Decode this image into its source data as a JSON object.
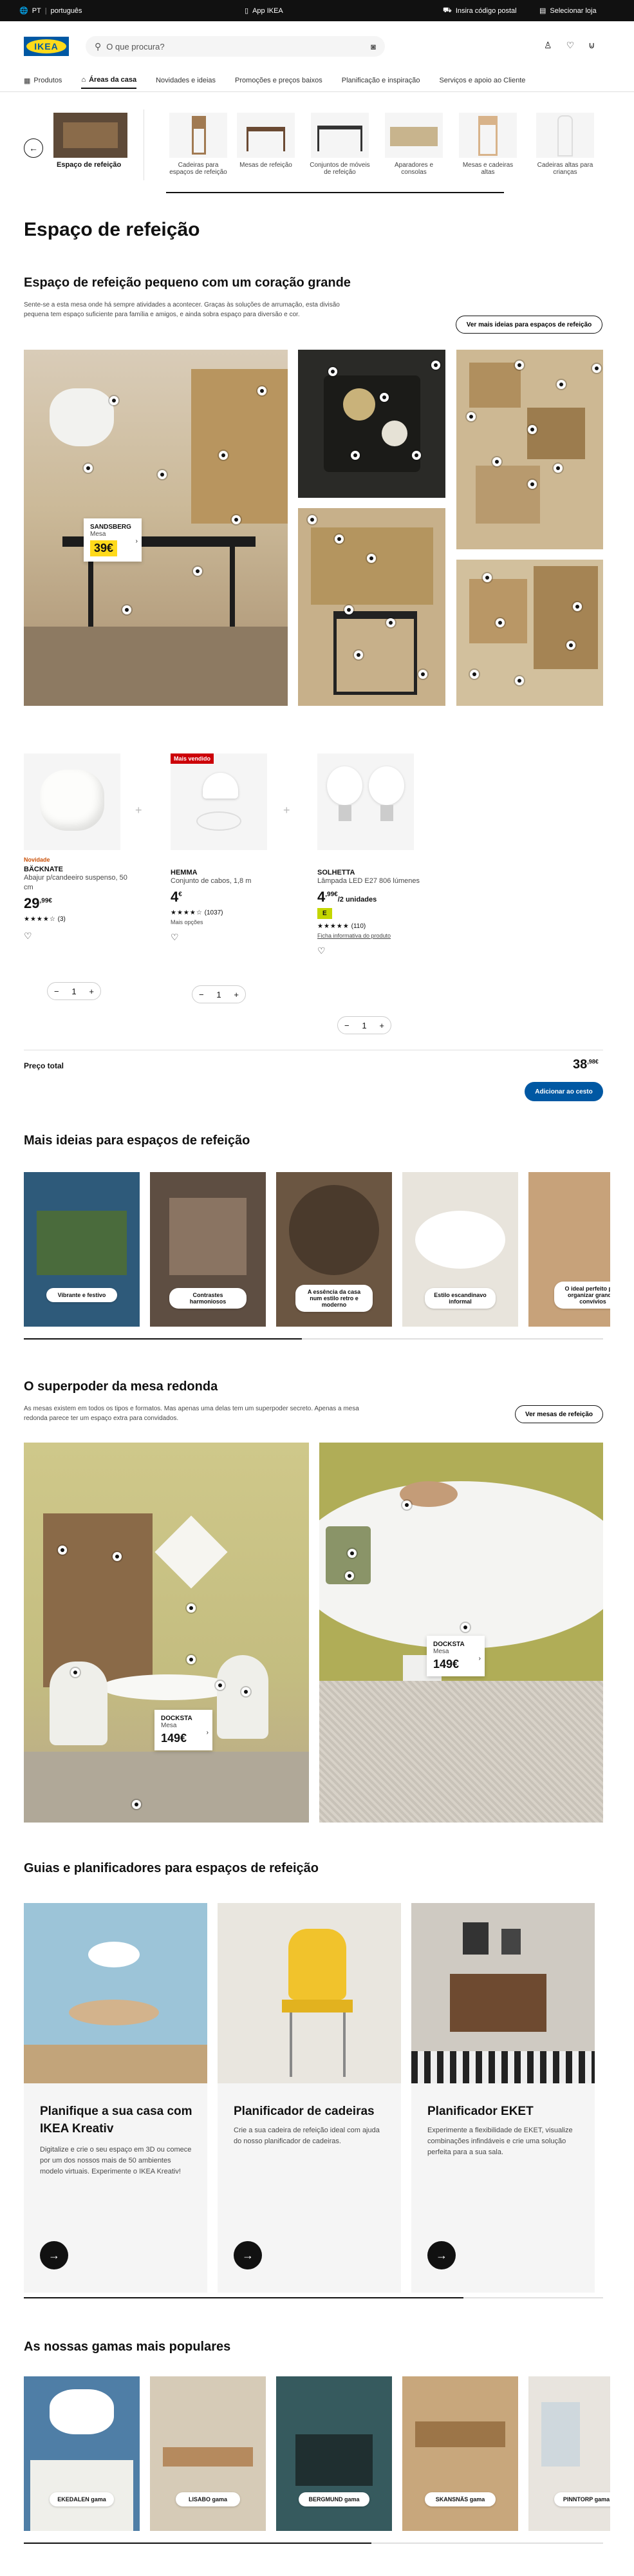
{
  "topbar": {
    "country": "PT",
    "language": "português",
    "app": "App IKEA",
    "postal": "Insira código postal",
    "store": "Selecionar loja"
  },
  "header": {
    "logo": "IKEA",
    "search_placeholder": "O que procura?"
  },
  "nav": [
    "Produtos",
    "Áreas da casa",
    "Novidades e ideias",
    "Promoções e preços baixos",
    "Planificação e inspiração",
    "Serviços e apoio ao Cliente"
  ],
  "catstrip": {
    "current": "Espaço de refeição",
    "items": [
      "Cadeiras para espaços de refeição",
      "Mesas de refeição",
      "Conjuntos de móveis de refeição",
      "Aparadores e consolas",
      "Mesas e cadeiras altas",
      "Cadeiras altas para crianças"
    ]
  },
  "page_title": "Espaço de refeição",
  "section1": {
    "title": "Espaço de refeição pequeno com um coração grande",
    "text": "Sente-se a esta mesa onde há sempre atividades a acontecer. Graças às soluções de arrumação, esta divisão pequena tem espaço suficiente para família e amigos, e ainda sobra espaço para diversão e cor.",
    "button": "Ver mais ideias para espaços de refeição",
    "tag": {
      "name": "SANDSBERG",
      "type": "Mesa",
      "price": "39€"
    }
  },
  "products": [
    {
      "badge": "Novidade",
      "name": "BÄCKNATE",
      "desc": "Abajur p/candeeiro suspenso, 50 cm",
      "price": "29",
      "cents": ",99€",
      "rating": "★★★★☆",
      "reviews": "(3)"
    },
    {
      "badge": "Mais vendido",
      "name": "HEMMA",
      "desc": "Conjunto de cabos, 1,8 m",
      "price": "4",
      "cents": "€",
      "rating": "★★★★☆",
      "reviews": "(1037)",
      "options": "Mais opções"
    },
    {
      "badge": "",
      "name": "SOLHETTA",
      "desc": "Lâmpada LED E27 806 lúmenes",
      "price": "4",
      "cents": ",99€",
      "per": "/2 unidades",
      "energy": "E",
      "rating": "★★★★★",
      "reviews": "(110)",
      "info": "Ficha informativa do produto"
    }
  ],
  "qty": "1",
  "total": {
    "label": "Preço total",
    "value": "38",
    "cents": ",98€",
    "button": "Adicionar ao cesto"
  },
  "ideas": {
    "title": "Mais ideias para espaços de refeição",
    "items": [
      "Vibrante e festivo",
      "Contrastes harmoniosos",
      "A essência da casa num estilo retro e moderno",
      "Estilo escandinavo informal",
      "O ideal perfeito para organizar grandes convívios"
    ]
  },
  "round": {
    "title": "O superpoder da mesa redonda",
    "text": "As mesas existem em todos os tipos e formatos. Mas apenas uma delas tem um superpoder secreto. Apenas a mesa redonda parece ter um espaço extra para convidados.",
    "button": "Ver mesas de refeição",
    "tag1": {
      "name": "DOCKSTA",
      "type": "Mesa",
      "price": "149€"
    },
    "tag2": {
      "name": "DOCKSTA",
      "type": "Mesa",
      "price": "149€"
    }
  },
  "guides": {
    "title": "Guias e planificadores para espaços de refeição",
    "cards": [
      {
        "title": "Planifique a sua casa com IKEA Kreativ",
        "text": "Digitalize e crie o seu espaço em 3D ou comece por um dos nossos mais de 50 ambientes modelo virtuais. Experimente o IKEA Kreativ!"
      },
      {
        "title": "Planificador de cadeiras",
        "text": "Crie a sua cadeira de refeição ideal com ajuda do nosso planificador de cadeiras."
      },
      {
        "title": "Planificador EKET",
        "text": "Experimente a flexibilidade de EKET, visualize combinações infindáveis e crie uma solução perfeita para a sua sala."
      }
    ]
  },
  "ranges": {
    "title": "As nossas gamas mais populares",
    "items": [
      "EKEDALEN gama",
      "LISABO gama",
      "BERGMUND gama",
      "SKANSNÄS gama",
      "PINNTORP gama"
    ]
  },
  "colors": {
    "brand_blue": "#0058a3",
    "brand_yellow": "#ffda1a",
    "badge_orange": "#ca5008",
    "badge_red": "#cc0008"
  }
}
